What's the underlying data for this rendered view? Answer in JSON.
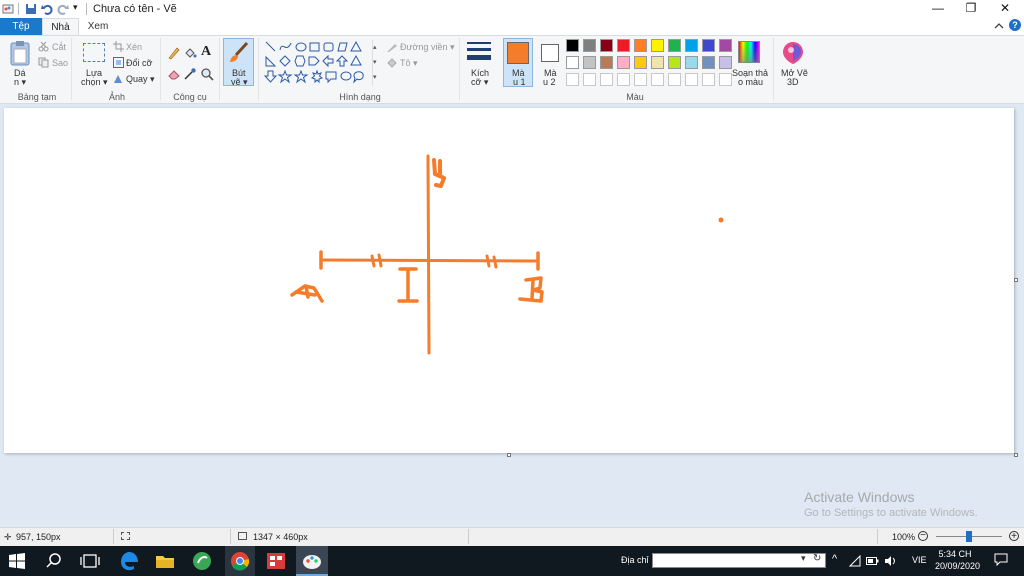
{
  "window": {
    "title": "Chưa có tên - Vẽ",
    "controls": {
      "minimize": "—",
      "maximize": "❐",
      "close": "✕"
    }
  },
  "tabs": [
    {
      "label": "Tệp"
    },
    {
      "label": "Nhà"
    },
    {
      "label": "Xem"
    }
  ],
  "ribbon": {
    "clipboard": {
      "paste_label_1": "Dá",
      "paste_label_2": "n ▾",
      "cut": "Cắt",
      "copy": "Sao",
      "group": "Bảng tạm"
    },
    "image": {
      "select_1": "Lựa",
      "select_2": "chọn ▾",
      "crop": "Xén",
      "resize": "Đổi cỡ",
      "rotate": "Quay ▾",
      "group": "Ảnh"
    },
    "tools": {
      "group": "Công cụ"
    },
    "brush": {
      "label_1": "Bút",
      "label_2": "vẽ ▾"
    },
    "shapes": {
      "outline": "Đường viền ▾",
      "fill": "Tô ▾",
      "group": "Hình dạng"
    },
    "size": {
      "label_1": "Kích",
      "label_2": "cỡ ▾"
    },
    "color1": {
      "label_1": "Mà",
      "label_2": "u 1",
      "value": "#f57c2b"
    },
    "color2": {
      "label_1": "Mà",
      "label_2": "u 2",
      "value": "#ffffff"
    },
    "palette_row1": [
      "#000000",
      "#7f7f7f",
      "#880015",
      "#ed1c24",
      "#ff7f27",
      "#fff200",
      "#22b14c",
      "#00a2e8",
      "#3f48cc",
      "#a349a4"
    ],
    "palette_row2": [
      "#ffffff",
      "#c3c3c3",
      "#b97a57",
      "#ffaec9",
      "#ffc90e",
      "#efe4b0",
      "#b5e61d",
      "#99d9ea",
      "#7092be",
      "#c8bfe7"
    ],
    "edit_colors_1": "Soạn thả",
    "edit_colors_2": "o màu",
    "paint3d_1": "Mở Vẽ",
    "paint3d_2": "3D",
    "colors_group": "Màu"
  },
  "canvas": {
    "stroke_color": "#f57c2b",
    "background": "#ffffff"
  },
  "watermark": {
    "line1": "Activate Windows",
    "line2": "Go to Settings to activate Windows."
  },
  "status": {
    "cursor_pos": "957, 150px",
    "canvas_size": "1347 × 460px",
    "zoom": "100%"
  },
  "taskbar": {
    "address_label": "Địa chỉ",
    "language": "VIE",
    "time": "5:34 CH",
    "date": "20/09/2020"
  }
}
